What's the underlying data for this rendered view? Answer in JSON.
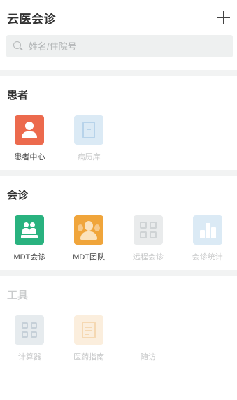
{
  "header": {
    "title": "云医会诊",
    "add_icon": "plus-icon"
  },
  "search": {
    "placeholder": "姓名/住院号",
    "value": "",
    "icon": "search-icon"
  },
  "sections": {
    "patient": {
      "title": "患者",
      "items": [
        {
          "label": "患者中心",
          "icon": "person-icon",
          "color": "#ec6a4d",
          "enabled": true
        },
        {
          "label": "病历库",
          "icon": "medical-record-icon",
          "color": "#dbeaf5",
          "enabled": false
        }
      ]
    },
    "consult": {
      "title": "会诊",
      "items": [
        {
          "label": "MDT会诊",
          "icon": "group-consult-icon",
          "color": "#29b27f",
          "enabled": true
        },
        {
          "label": "MDT团队",
          "icon": "team-icon",
          "color": "#f0a53b",
          "enabled": true
        },
        {
          "label": "远程会诊",
          "icon": "remote-consult-icon",
          "color": "#e9ebec",
          "enabled": false
        },
        {
          "label": "会诊统计",
          "icon": "statistics-chart-icon",
          "color": "#dbeaf5",
          "enabled": false
        }
      ]
    },
    "tools": {
      "title": "工具",
      "items": [
        {
          "label": "计算器",
          "icon": "calculator-icon",
          "color": "#e6ebee",
          "enabled": false
        },
        {
          "label": "医药指南",
          "icon": "guide-book-icon",
          "color": "#fbeedd",
          "enabled": false
        },
        {
          "label": "随访",
          "icon": "",
          "color": "",
          "enabled": false
        }
      ]
    }
  }
}
